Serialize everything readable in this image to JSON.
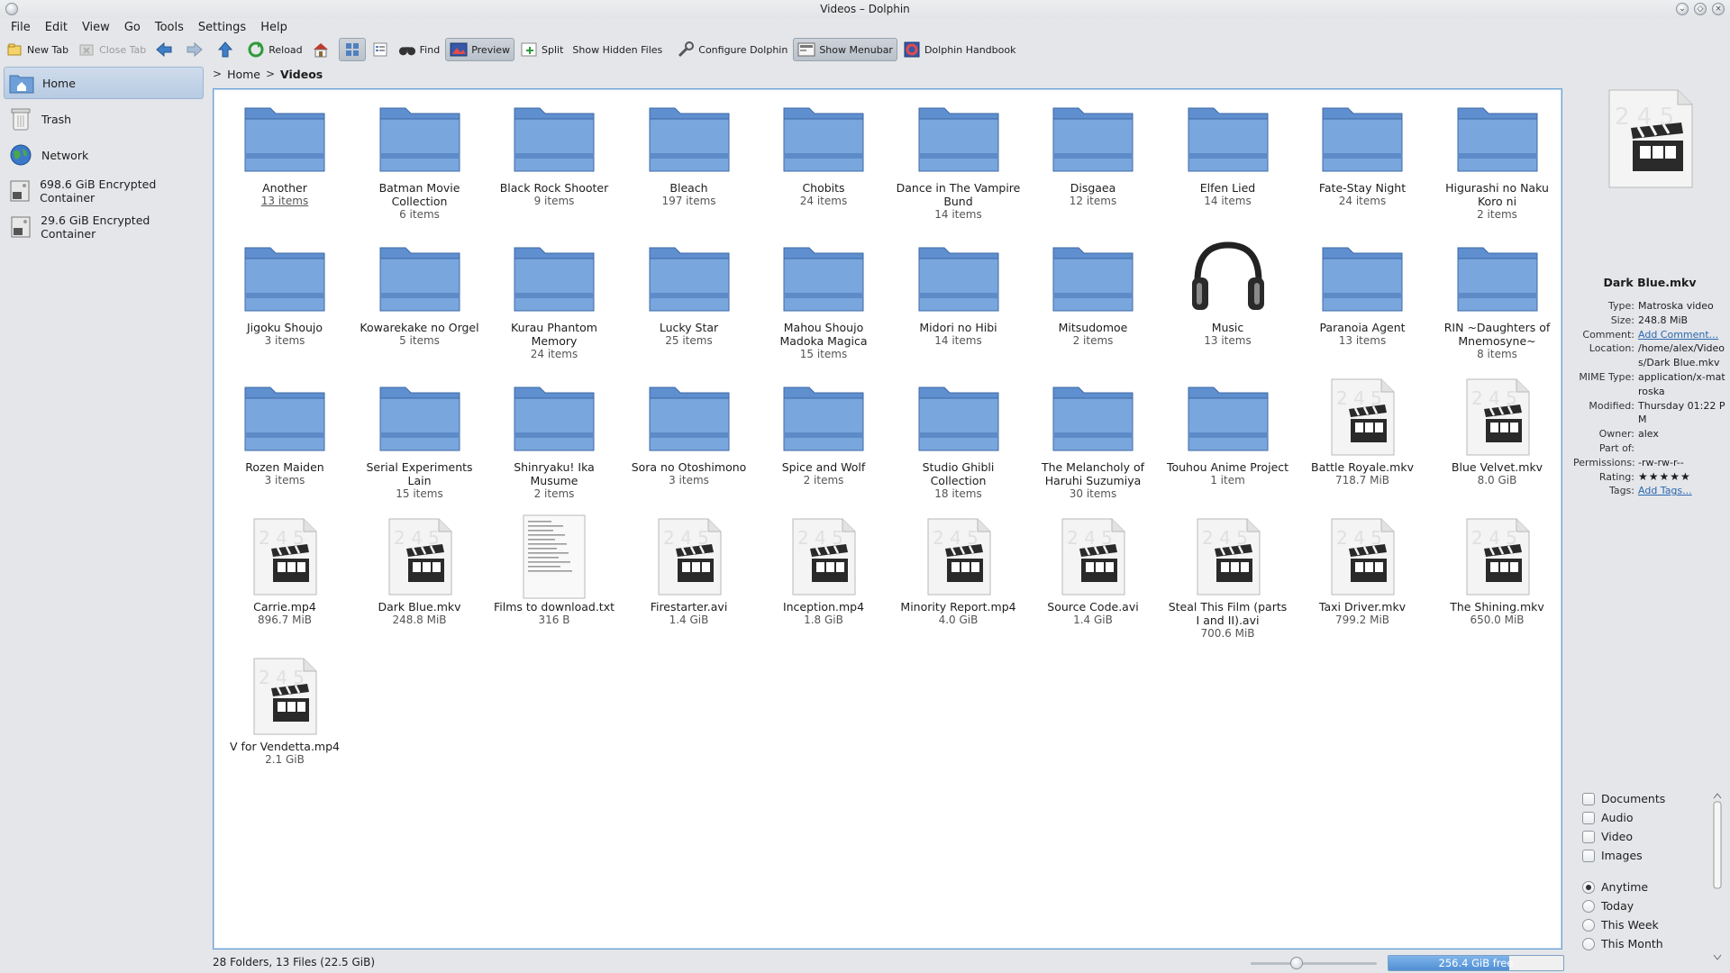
{
  "window": {
    "title": "Videos – Dolphin",
    "close_glyph": "×"
  },
  "menubar": [
    "File",
    "Edit",
    "View",
    "Go",
    "Tools",
    "Settings",
    "Help"
  ],
  "toolbar": {
    "new_tab": "New Tab",
    "close_tab": "Close Tab",
    "reload": "Reload",
    "find": "Find",
    "preview": "Preview",
    "split": "Split",
    "show_hidden": "Show Hidden Files",
    "configure": "Configure Dolphin",
    "show_menubar": "Show Menubar",
    "handbook": "Dolphin Handbook"
  },
  "places": [
    {
      "label": "Home",
      "icon": "home-folder-icon"
    },
    {
      "label": "Trash",
      "icon": "trash-icon"
    },
    {
      "label": "Network",
      "icon": "network-globe-icon"
    },
    {
      "label": "698.6 GiB Encrypted Container",
      "icon": "drive-icon"
    },
    {
      "label": "29.6 GiB Encrypted Container",
      "icon": "drive-icon"
    }
  ],
  "breadcrumb": {
    "home": "Home",
    "separator": ">",
    "current": "Videos"
  },
  "items": [
    {
      "name": "Another",
      "sub": "13 items",
      "type": "folder"
    },
    {
      "name": "Batman Movie Collection",
      "sub": "6 items",
      "type": "folder"
    },
    {
      "name": "Black Rock Shooter",
      "sub": "9 items",
      "type": "folder"
    },
    {
      "name": "Bleach",
      "sub": "197 items",
      "type": "folder"
    },
    {
      "name": "Chobits",
      "sub": "24 items",
      "type": "folder"
    },
    {
      "name": "Dance in The Vampire Bund",
      "sub": "14 items",
      "type": "folder"
    },
    {
      "name": "Disgaea",
      "sub": "12 items",
      "type": "folder"
    },
    {
      "name": "Elfen Lied",
      "sub": "14 items",
      "type": "folder"
    },
    {
      "name": "Fate-Stay Night",
      "sub": "24 items",
      "type": "folder"
    },
    {
      "name": "Higurashi no Naku Koro ni",
      "sub": "2 items",
      "type": "folder"
    },
    {
      "name": "Jigoku Shoujo",
      "sub": "3 items",
      "type": "folder"
    },
    {
      "name": "Kowarekake no Orgel",
      "sub": "5 items",
      "type": "folder"
    },
    {
      "name": "Kurau Phantom Memory",
      "sub": "24 items",
      "type": "folder"
    },
    {
      "name": "Lucky Star",
      "sub": "25 items",
      "type": "folder"
    },
    {
      "name": "Mahou Shoujo Madoka Magica",
      "sub": "15 items",
      "type": "folder"
    },
    {
      "name": "Midori no Hibi",
      "sub": "14 items",
      "type": "folder"
    },
    {
      "name": "Mitsudomoe",
      "sub": "2 items",
      "type": "folder"
    },
    {
      "name": "Music",
      "sub": "13 items",
      "type": "music"
    },
    {
      "name": "Paranoia Agent",
      "sub": "13 items",
      "type": "folder"
    },
    {
      "name": "RIN ~Daughters of Mnemosyne~",
      "sub": "8 items",
      "type": "folder"
    },
    {
      "name": "Rozen Maiden",
      "sub": "3 items",
      "type": "folder"
    },
    {
      "name": "Serial Experiments Lain",
      "sub": "15 items",
      "type": "folder"
    },
    {
      "name": "Shinryaku! Ika Musume",
      "sub": "2 items",
      "type": "folder"
    },
    {
      "name": "Sora no Otoshimono",
      "sub": "3 items",
      "type": "folder"
    },
    {
      "name": "Spice and Wolf",
      "sub": "2 items",
      "type": "folder"
    },
    {
      "name": "Studio Ghibli Collection",
      "sub": "18 items",
      "type": "folder"
    },
    {
      "name": "The Melancholy of Haruhi Suzumiya",
      "sub": "30 items",
      "type": "folder"
    },
    {
      "name": "Touhou Anime Project",
      "sub": "1 item",
      "type": "folder"
    },
    {
      "name": "Battle Royale.mkv",
      "sub": "718.7 MiB",
      "type": "video"
    },
    {
      "name": "Blue Velvet.mkv",
      "sub": "8.0 GiB",
      "type": "video"
    },
    {
      "name": "Carrie.mp4",
      "sub": "896.7 MiB",
      "type": "video"
    },
    {
      "name": "Dark Blue.mkv",
      "sub": "248.8 MiB",
      "type": "video"
    },
    {
      "name": "Films to download.txt",
      "sub": "316 B",
      "type": "text"
    },
    {
      "name": "Firestarter.avi",
      "sub": "1.4 GiB",
      "type": "video"
    },
    {
      "name": "Inception.mp4",
      "sub": "1.8 GiB",
      "type": "video"
    },
    {
      "name": "Minority Report.mp4",
      "sub": "4.0 GiB",
      "type": "video"
    },
    {
      "name": "Source Code.avi",
      "sub": "1.4 GiB",
      "type": "video"
    },
    {
      "name": "Steal This Film (parts I and II).avi",
      "sub": "700.6 MiB",
      "type": "video"
    },
    {
      "name": "Taxi Driver.mkv",
      "sub": "799.2 MiB",
      "type": "video"
    },
    {
      "name": "The Shining.mkv",
      "sub": "650.0 MiB",
      "type": "video"
    },
    {
      "name": "V for Vendetta.mp4",
      "sub": "2.1 GiB",
      "type": "video"
    }
  ],
  "info": {
    "file_name": "Dark Blue.mkv",
    "rows": [
      {
        "k": "Type:",
        "v": "Matroska video",
        "link": false
      },
      {
        "k": "Size:",
        "v": "248.8 MiB",
        "link": false
      },
      {
        "k": "Comment:",
        "v": "Add Comment...",
        "link": true
      },
      {
        "k": "Location:",
        "v": "/home/alex/Videos/Dark Blue.mkv",
        "link": false
      },
      {
        "k": "MIME Type:",
        "v": "application/x-matroska",
        "link": false
      },
      {
        "k": "Modified:",
        "v": "Thursday 01:22 PM",
        "link": false
      },
      {
        "k": "Owner:",
        "v": "alex",
        "link": false
      },
      {
        "k": "Part of:",
        "v": "",
        "link": false
      },
      {
        "k": "Permissions:",
        "v": "-rw-rw-r--",
        "link": false
      },
      {
        "k": "Rating:",
        "v": "",
        "link": false,
        "rating": 0
      },
      {
        "k": "Tags:",
        "v": "Add Tags...",
        "link": true
      }
    ]
  },
  "filters": {
    "types": [
      "Documents",
      "Audio",
      "Video",
      "Images"
    ],
    "dates": [
      "Anytime",
      "Today",
      "This Week",
      "This Month"
    ],
    "selected_date": "Anytime"
  },
  "status": {
    "summary": "28 Folders, 13 Files (22.5 GiB)",
    "free_space": "256.4 GiB free",
    "used_fraction": 0.69
  },
  "colors": {
    "accent": "#4f8fd3",
    "folder": "#6f9fd8",
    "selection": "#b7cbe3"
  }
}
